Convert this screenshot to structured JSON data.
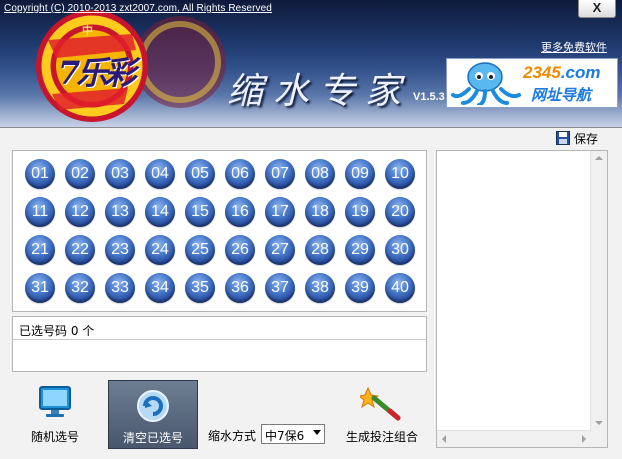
{
  "header": {
    "copyright": "Copyright (C) 2010-2013 zxt2007.com, All Rights Reserved",
    "close_label": "X",
    "more_link": "更多免费软件",
    "app_title": "缩水专家",
    "version": "V1.5.3",
    "logo_text": "7乐彩",
    "logo_small": "中",
    "ad": {
      "site": "2345",
      "domain": ".com",
      "tagline": "网址导航"
    }
  },
  "toolbar": {
    "save_label": "保存",
    "save_icon": "floppy-disk-icon"
  },
  "balls": [
    "01",
    "02",
    "03",
    "04",
    "05",
    "06",
    "07",
    "08",
    "09",
    "10",
    "11",
    "12",
    "13",
    "14",
    "15",
    "16",
    "17",
    "18",
    "19",
    "20",
    "21",
    "22",
    "23",
    "24",
    "25",
    "26",
    "27",
    "28",
    "29",
    "30",
    "31",
    "32",
    "33",
    "34",
    "35",
    "36",
    "37",
    "38",
    "39",
    "40"
  ],
  "selected": {
    "status": "已选号码 0 个"
  },
  "actions": {
    "random_label": "随机选号",
    "clear_label": "清空已选号",
    "mode_label": "缩水方式",
    "mode_value": "中7保6",
    "generate_label": "生成投注组合"
  },
  "colors": {
    "ball": "#2a55a8",
    "header_top": "#0e1a3a",
    "accent": "#1b7be0"
  }
}
